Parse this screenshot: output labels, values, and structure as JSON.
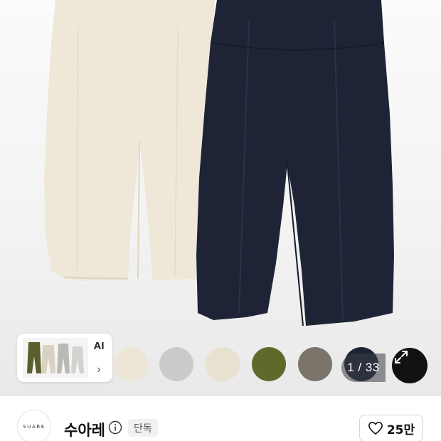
{
  "gallery": {
    "current_index": 1,
    "total": 33,
    "counter_text": "1 / 33",
    "ai_chip": {
      "label": "AI",
      "chevron": "›"
    },
    "swatches": [
      {
        "color": "#ece5d8"
      },
      {
        "color": "#c9cbc9"
      },
      {
        "color": "#e6e2cf"
      },
      {
        "color": "#5e6a2a"
      },
      {
        "color": "#7b746a"
      },
      {
        "color": "#1d2436"
      }
    ],
    "expand_icon": "expand-arrows-icon"
  },
  "shop": {
    "logo_text": "SUARE",
    "name": "수아레",
    "info_icon": "info-icon",
    "badge": "단독"
  },
  "like": {
    "icon": "heart-outline-icon",
    "count": "25만"
  }
}
